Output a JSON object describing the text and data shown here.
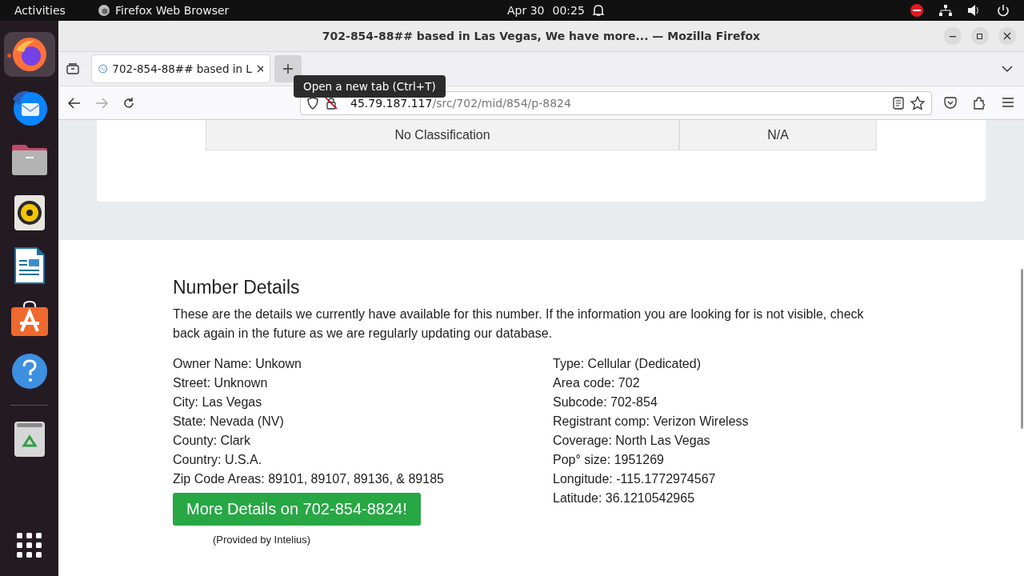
{
  "top_bar": {
    "activities": "Activities",
    "app_name": "Firefox Web Browser",
    "date": "Apr 30",
    "time": "00:25"
  },
  "dock": [
    {
      "kind": "browser",
      "active": true
    },
    {
      "kind": "mail",
      "active": false
    },
    {
      "kind": "folder",
      "active": false
    },
    {
      "kind": "speaker",
      "active": false
    },
    {
      "kind": "document",
      "active": false
    },
    {
      "kind": "store",
      "active": false
    },
    {
      "kind": "help",
      "active": false
    },
    {
      "kind": "separator"
    },
    {
      "kind": "trash",
      "active": false
    }
  ],
  "window": {
    "title": "702-854-88## based in Las Vegas, We have more... — Mozilla Firefox"
  },
  "tabs": [
    {
      "title": "702-854-88## based in L",
      "selected": true
    }
  ],
  "tooltip": "Open a new tab (Ctrl+T)",
  "url": {
    "host": "45.79.187.117",
    "path": "/src/702/mid/854/p-8824"
  },
  "table": {
    "rows": [
      [
        "No Classification",
        "N/A"
      ]
    ]
  },
  "section": {
    "title": "Number Details",
    "description": "These are the details we currently have available for this number. If the information you are looking for is not visible, check back again in the future as we are regularly updating our database.",
    "left": [
      "Owner Name: Unkown",
      "Street: Unknown",
      "City: Las Vegas",
      "State: Nevada (NV)",
      "County: Clark",
      "Country: U.S.A.",
      "Zip Code Areas: 89101, 89107, 89136, & 89185"
    ],
    "right": [
      "Type: Cellular (Dedicated)",
      "Area code: 702",
      "Subcode: 702-854",
      "Registrant comp: Verizon Wireless",
      "Coverage: North Las Vegas",
      "Pop° size: 1951269",
      "Longitude: -115.1772974567",
      "Latitude: 36.1210542965"
    ],
    "button": "More Details on 702-854-8824!",
    "note": "(Provided by Intelius)"
  }
}
